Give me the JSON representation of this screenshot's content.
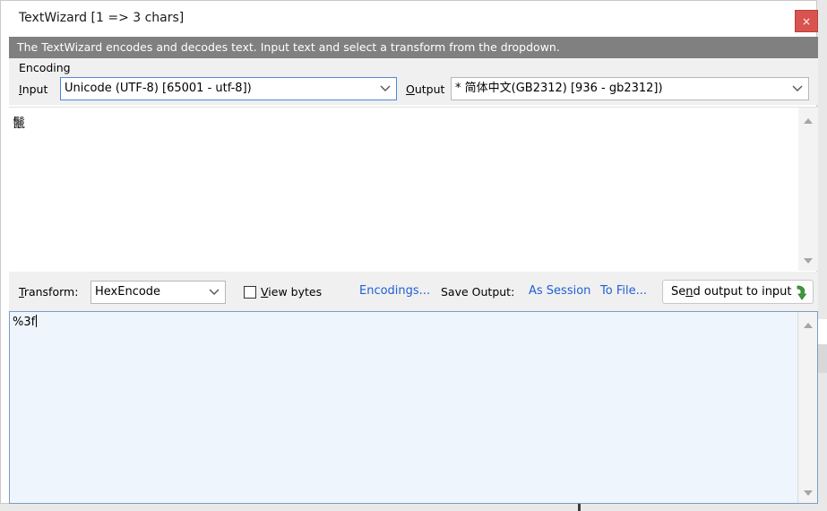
{
  "window": {
    "title": "TextWizard [1 => 3 chars]",
    "close_label": "×"
  },
  "info": {
    "text": "The TextWizard encodes and decodes text. Input text and select a transform from the dropdown."
  },
  "encoding": {
    "group_label": "Encoding",
    "input_label_ul": "I",
    "input_label_rest": "nput",
    "input_value": "Unicode (UTF-8) [65001 - utf-8])",
    "output_label_ul": "O",
    "output_label_rest": "utput",
    "output_value": "* 简体中文(GB2312) [936 - gb2312])"
  },
  "input_text": "鬛",
  "toolbar": {
    "transform_label_ul": "T",
    "transform_label_rest": "ransform:",
    "transform_value": "HexEncode",
    "view_bytes_ul": "V",
    "view_bytes_rest": "iew bytes",
    "view_bytes_checked": false,
    "encodings_link": "Encodings...",
    "save_output_label": "Save Output:",
    "as_session_link": "As Session",
    "to_file_link": "To File...",
    "send_pre": "Se",
    "send_ul": "n",
    "send_post": "d output to input"
  },
  "output_text": "%3f",
  "colors": {
    "info_bar": "#808080",
    "close_button": "#d9534f",
    "link": "#1f5fd6",
    "output_bg": "#eef5fd",
    "arrow": "#3c9a3c"
  }
}
